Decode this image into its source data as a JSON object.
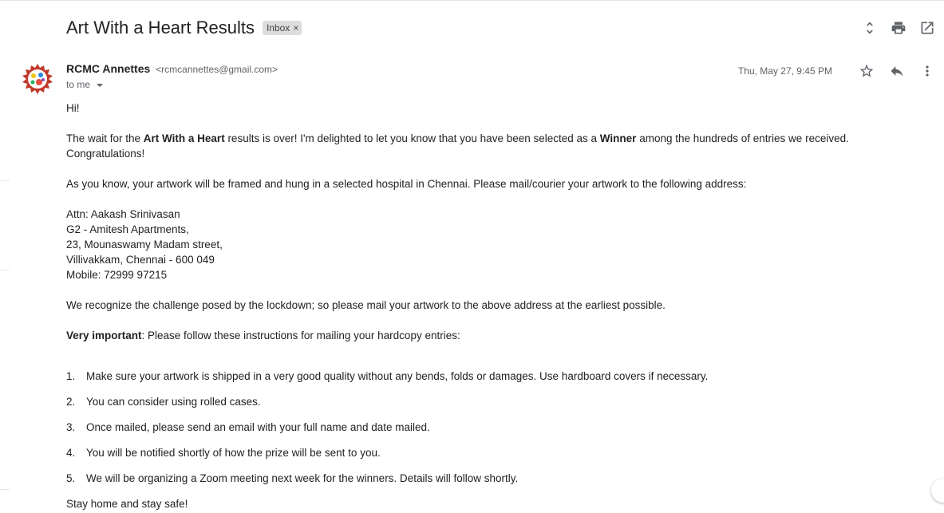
{
  "header": {
    "subject": "Art With a Heart Results",
    "label": "Inbox",
    "label_remove": "×",
    "actions": [
      "expand-collapse-icon",
      "print-icon",
      "open-new-window-icon"
    ]
  },
  "message": {
    "sender_name": "RCMC Annettes",
    "sender_email": "<rcmcannettes@gmail.com>",
    "to": "to me",
    "date": "Thu, May 27, 9:45 PM",
    "greeting": "Hi!",
    "p1_a": "The wait for the ",
    "p1_b": "Art With a Heart",
    "p1_c": " results is over! I'm delighted to let you know that you have been selected as a ",
    "p1_d": "Winner",
    "p1_e": " among the hundreds of entries we received. Congratulations!",
    "p2": "As you know, your artwork will be framed and hung in a selected hospital in Chennai. Please mail/courier your artwork to the following address:",
    "address": [
      "Attn: Aakash Srinivasan",
      "G2 - Amitesh Apartments,",
      "23, Mounaswamy Madam street,",
      "Villivakkam, Chennai - 600 049",
      "Mobile: 72999 97215"
    ],
    "p3": "We recognize the challenge posed by the lockdown; so please mail your artwork to the above address at the earliest possible.",
    "p4_bold": "Very important",
    "p4_rest": ": Please follow these instructions for mailing your hardcopy entries:",
    "instructions": [
      {
        "num": "1.",
        "text": "Make sure your artwork is shipped in a very good quality without any bends, folds or damages. Use hardboard covers if necessary."
      },
      {
        "num": "2.",
        "text": "You can consider using rolled cases."
      },
      {
        "num": "3.",
        "text": "Once mailed, please send an email with your full name and date mailed."
      },
      {
        "num": "4.",
        "text": "You will be notified shortly of how the prize will be sent to you."
      },
      {
        "num": "5.",
        "text": "We will be organizing a Zoom meeting next week for the winners. Details will follow shortly."
      }
    ],
    "closing": "Stay home and stay safe!"
  },
  "colors": {
    "chip_bg": "#dddddd",
    "icon": "#5f6368",
    "text": "#222222"
  }
}
